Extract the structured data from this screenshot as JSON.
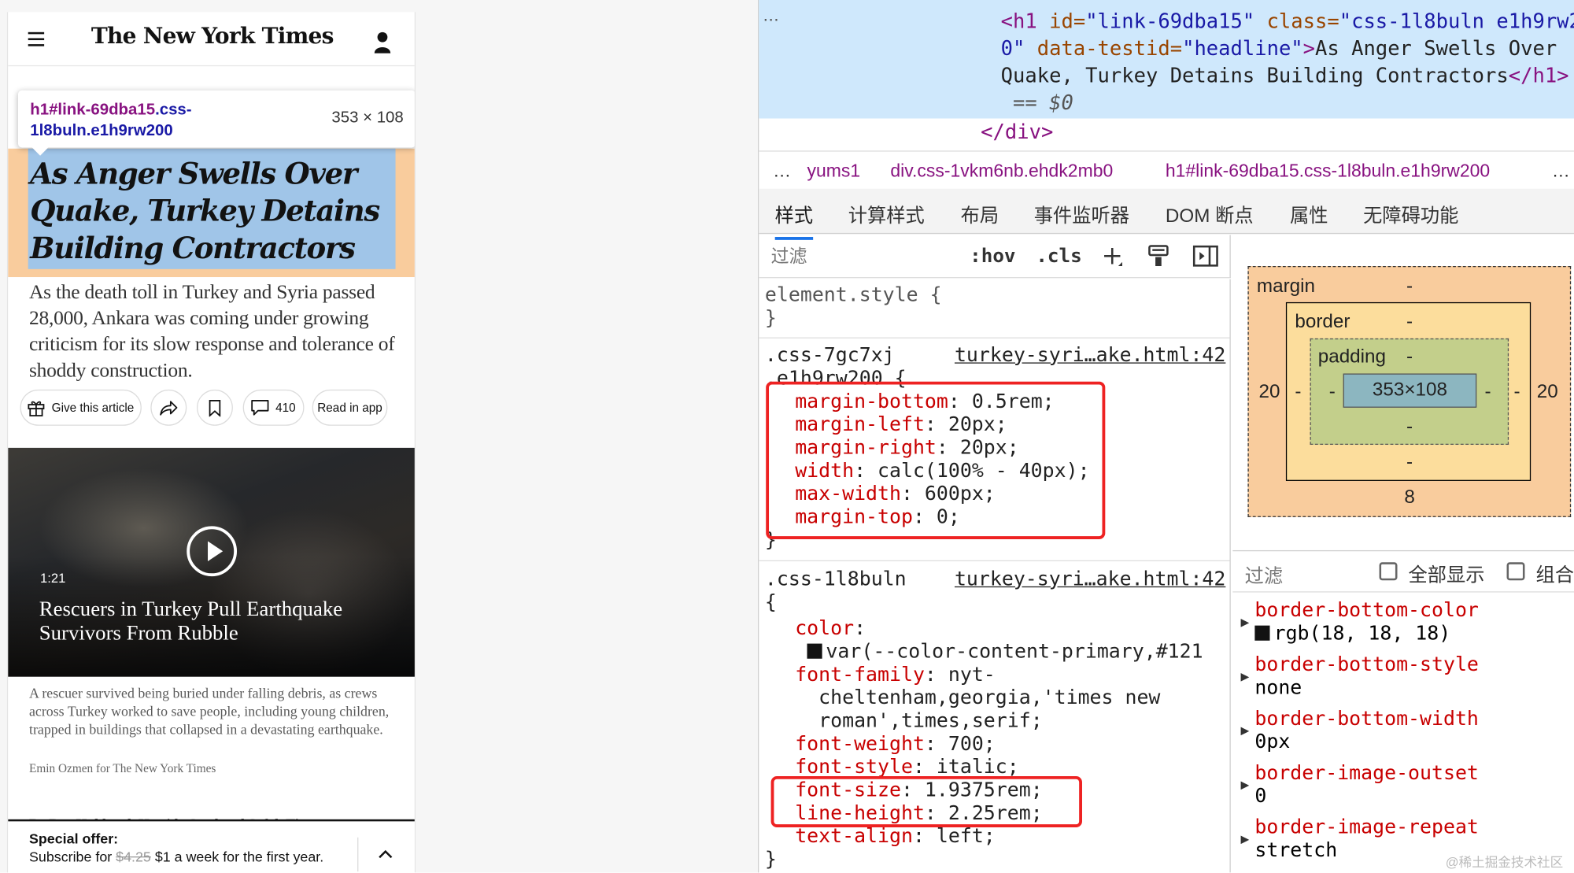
{
  "nyt": {
    "logo": "The New York Times",
    "tooltip": {
      "selector": "h1#link-69dba15",
      "classes": ".css-1l8buln.e1h9rw200",
      "size": "353 × 108"
    },
    "headline": "As Anger Swells Over Quake, Turkey Detains Building Contractors",
    "summary": "As the death toll in Turkey and Syria passed 28,000, Ankara was coming under growing criticism for its slow response and tolerance of shoddy construction.",
    "actions": {
      "gift": "Give this article",
      "comments": "410",
      "read_in_app": "Read in app"
    },
    "video": {
      "duration": "1:21",
      "title": "Rescuers in Turkey Pull Earthquake Survivors From Rubble"
    },
    "caption": "A rescuer survived being buried under falling debris, as crews across Turkey worked to save people, including young children, trapped in buildings that collapsed in a devastating earthquake.",
    "credit": "Emin Ozmen for The New York Times",
    "byline": "By Ben Hubbard, Hwaida Saad and Safak Timur",
    "offer": {
      "title": "Special offer:",
      "line_a": "Subscribe for",
      "old_price": "$4.25",
      "line_b": "$1 a week for the first year."
    }
  },
  "devtools": {
    "dots": "⋯",
    "element": {
      "open_tag": "<h1",
      "id_attr": " id=",
      "id_val": "\"link-69dba15\"",
      "class_attr": " class=",
      "class_val_a": "\"css-1l8buln e1h9rw20",
      "class_val_b": "0\"",
      "testid_attr": " data-testid=",
      "testid_val": "\"headline\"",
      "gt": ">",
      "text_a": "As Anger Swells Over",
      "text_b": "Quake, Turkey Detains Building Contractors",
      "close_tag": "</h1>",
      "dollar": " == $0"
    },
    "div_close": "</div>",
    "breadcrumbs": [
      "…",
      "yums1",
      "div.css-1vkm6nb.ehdk2mb0",
      "h1#link-69dba15.css-1l8buln.e1h9rw200",
      "…"
    ],
    "tabs": [
      "样式",
      "计算样式",
      "布局",
      "事件监听器",
      "DOM 断点",
      "属性",
      "无障碍功能"
    ],
    "filter_placeholder": "过滤",
    "hov": ":hov",
    "cls": ".cls",
    "element_style": [
      "element.style {",
      "}"
    ],
    "rule1": {
      "selector_a": ".css-7gc7xj",
      "selector_b": ".e1h9rw200 {",
      "source": "turkey-syri…ake.html:42",
      "props": [
        [
          "margin-bottom",
          "0.5rem"
        ],
        [
          "margin-left",
          "20px"
        ],
        [
          "margin-right",
          "20px"
        ],
        [
          "width",
          "calc(100% - 40px)"
        ],
        [
          "max-width",
          "600px"
        ],
        [
          "margin-top",
          "0"
        ]
      ],
      "close": "}"
    },
    "rule2": {
      "selector_a": ".css-1l8buln",
      "selector_b": "{",
      "source": "turkey-syri…ake.html:42",
      "color_prop": "color",
      "color_val": "var(--color-content-primary,#121",
      "ff_prop": "font-family",
      "ff_val_a": "nyt-",
      "ff_val_b": "cheltenham,georgia,'times new",
      "ff_val_c": "roman',times,serif;",
      "fw": [
        "font-weight",
        "700"
      ],
      "fs_style": [
        "font-style",
        "italic"
      ],
      "fsize": [
        "font-size",
        "1.9375rem"
      ],
      "lh": [
        "line-height",
        "2.25rem"
      ],
      "ta": [
        "text-align",
        "left"
      ],
      "close": "}"
    },
    "box_model": {
      "margin_label": "margin",
      "margin_top": "-",
      "margin_left": "20",
      "margin_right": "20",
      "margin_bottom": "8",
      "border_label": "border",
      "border_top": "-",
      "border_left": "-",
      "border_right": "-",
      "border_bottom": "-",
      "padding_label": "padding",
      "padding_top": "-",
      "padding_left": "-",
      "padding_right": "-",
      "padding_bottom": "-",
      "content": "353×108"
    },
    "computed_filter": {
      "label": "过滤",
      "show_all": "全部显示",
      "group": "组合"
    },
    "computed": [
      [
        "border-bottom-color",
        "rgb(18, 18, 18)"
      ],
      [
        "border-bottom-style",
        "none"
      ],
      [
        "border-bottom-width",
        "0px"
      ],
      [
        "border-image-outset",
        "0"
      ],
      [
        "border-image-repeat",
        "stretch"
      ]
    ],
    "watermark": "@稀土掘金技术社区"
  }
}
